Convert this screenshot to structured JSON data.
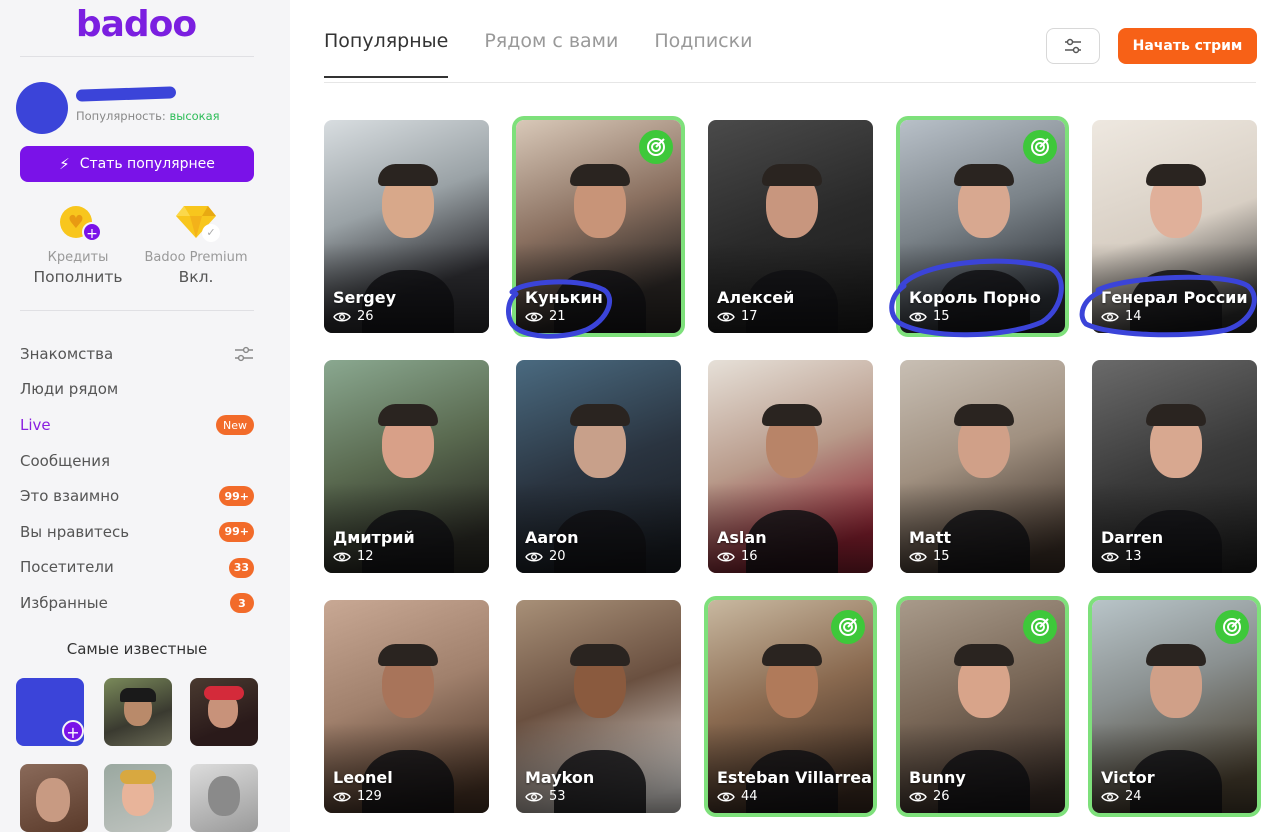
{
  "app": {
    "logo": "badoo"
  },
  "profile": {
    "popularity_label": "Популярность:",
    "popularity_value": "высокая",
    "boost_label": "Стать популярнее"
  },
  "wallet": {
    "credits_label": "Кредиты",
    "credits_action": "Пополнить",
    "premium_label": "Badoo Premium",
    "premium_value": "Вкл."
  },
  "nav": [
    {
      "label": "Знакомства",
      "extra": "filter-icon"
    },
    {
      "label": "Люди рядом"
    },
    {
      "label": "Live",
      "badge": "New",
      "active": true
    },
    {
      "label": "Сообщения"
    },
    {
      "label": "Это взаимно",
      "badge": "99+"
    },
    {
      "label": "Вы нравитесь",
      "badge": "99+"
    },
    {
      "label": "Посетители",
      "badge": "33"
    },
    {
      "label": "Избранные",
      "badge": "3"
    }
  ],
  "famous": {
    "title": "Самые известные"
  },
  "tabs": [
    {
      "label": "Популярные",
      "active": true
    },
    {
      "label": "Рядом с вами"
    },
    {
      "label": "Подписки"
    }
  ],
  "actions": {
    "stream_label": "Начать стрим"
  },
  "cards": [
    {
      "name": "Sergey",
      "views": "26",
      "featured": false
    },
    {
      "name": "Кунькин",
      "views": "21",
      "featured": true
    },
    {
      "name": "Алексей",
      "views": "17",
      "featured": false
    },
    {
      "name": "Король Порно",
      "views": "15",
      "featured": true
    },
    {
      "name": "Генерал России",
      "views": "14",
      "featured": false
    },
    {
      "name": "Дмитрий",
      "views": "12",
      "featured": false
    },
    {
      "name": "Aaron",
      "views": "20",
      "featured": false
    },
    {
      "name": "Aslan",
      "views": "16",
      "featured": false
    },
    {
      "name": "Matt",
      "views": "15",
      "featured": false
    },
    {
      "name": "Darren",
      "views": "13",
      "featured": false
    },
    {
      "name": "Leonel",
      "views": "129",
      "featured": false
    },
    {
      "name": "Maykon",
      "views": "53",
      "featured": false
    },
    {
      "name": "Esteban Villarreal",
      "views": "44",
      "featured": true
    },
    {
      "name": "Bunny",
      "views": "26",
      "featured": true
    },
    {
      "name": "Victor",
      "views": "24",
      "featured": true
    }
  ],
  "colors": {
    "brand": "#7a12e8",
    "stream_button": "#f76117",
    "badge": "#f26b2a",
    "featured_border": "#7ee07b",
    "target_badge": "#3ec83a",
    "annotation_scribble": "#3b44d9"
  }
}
